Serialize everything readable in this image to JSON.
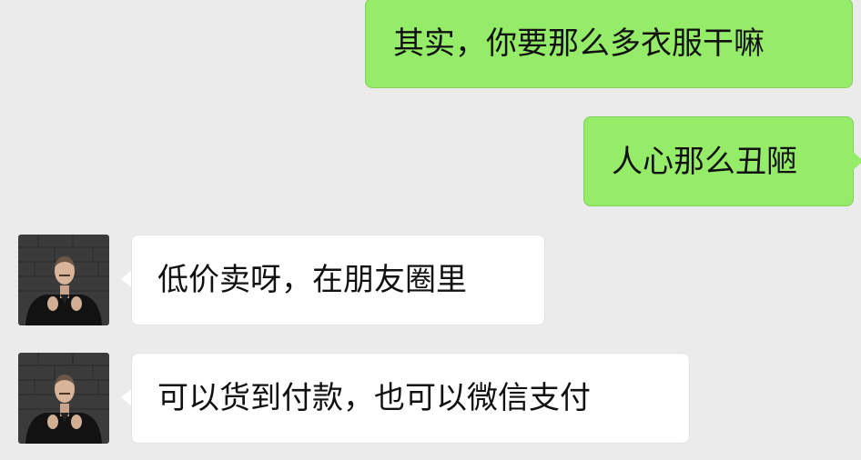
{
  "messages": [
    {
      "from": "self",
      "text": "其实，你要那么多衣服干嘛"
    },
    {
      "from": "self",
      "text": "人心那么丑陋"
    },
    {
      "from": "other",
      "text": "低价卖呀，在朋友圈里",
      "avatar": "contact-avatar"
    },
    {
      "from": "other",
      "text": "可以货到付款，也可以微信支付",
      "avatar": "contact-avatar"
    }
  ],
  "colors": {
    "background": "#ebebeb",
    "outgoing_bubble": "#95ec69",
    "incoming_bubble": "#ffffff",
    "text": "#111111"
  }
}
